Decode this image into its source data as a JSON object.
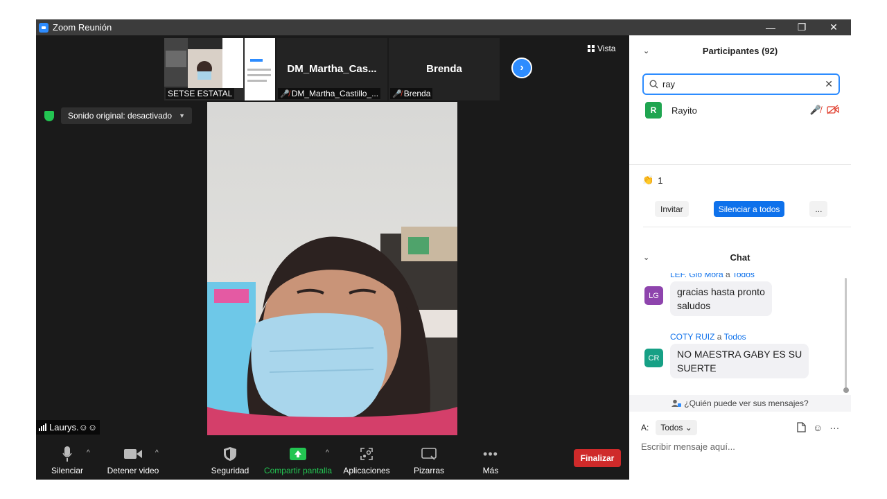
{
  "window": {
    "title": "Zoom Reunión",
    "minimize": "—",
    "restore": "❐",
    "close": "✕"
  },
  "thumbnails": [
    {
      "name": "SETSE ESTATAL",
      "muted": false
    },
    {
      "name": "DM_Martha_Castillo_...",
      "title": "DM_Martha_Cas...",
      "muted": true
    },
    {
      "name": "Brenda",
      "title": "Brenda",
      "muted": true
    }
  ],
  "view": {
    "label": "Vista"
  },
  "sound": {
    "label": "Sonido original: desactivado"
  },
  "speaker": {
    "name": "Laurys.☺☺"
  },
  "toolbar": {
    "mute": "Silenciar",
    "stop_video": "Detener video",
    "security": "Seguridad",
    "share": "Compartir pantalla",
    "apps": "Aplicaciones",
    "whiteboards": "Pizarras",
    "more": "Más",
    "end": "Finalizar"
  },
  "participants": {
    "title": "Participantes (92)",
    "search_value": "ray",
    "list": [
      {
        "initial": "R",
        "name": "Rayito",
        "avatar_color": "#1fa550"
      }
    ],
    "reaction_count": "1",
    "invite": "Invitar",
    "mute_all": "Silenciar a todos",
    "more": "..."
  },
  "chat": {
    "title": "Chat",
    "messages": [
      {
        "initials": "LG",
        "from": "LEF. Glo Mora",
        "connector": "a",
        "to": "Todos",
        "text_line1": "gracias hasta pronto",
        "text_line2": "saludos",
        "avatar_color": "#8e44ad"
      },
      {
        "initials": "CR",
        "from": "COTY RUIZ",
        "connector": "a",
        "to": "Todos",
        "text_line1": "NO MAESTRA GABY ES SU",
        "text_line2": "SUERTE",
        "avatar_color": "#16a085"
      }
    ],
    "who_can_see": "¿Quién puede ver sus mensajes?",
    "to_label": "A:",
    "recipient": "Todos",
    "placeholder": "Escribir mensaje aquí..."
  },
  "colors": {
    "accent": "#2d8cff",
    "end_button": "#cf2a2a",
    "share_green": "#23c552",
    "muted_red": "#e03e2d"
  }
}
